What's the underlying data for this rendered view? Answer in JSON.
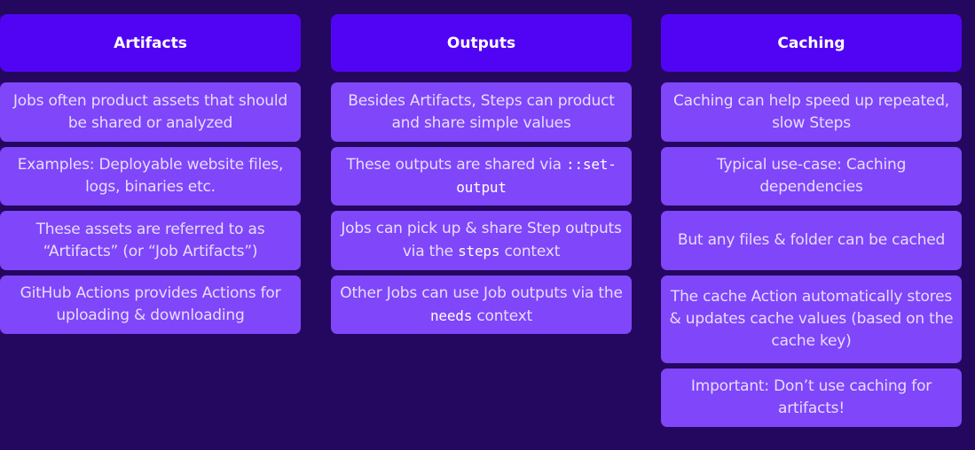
{
  "columns": [
    {
      "title": "Artifacts",
      "cards": [
        [
          {
            "t": "Jobs often product assets that should be shared or analyzed"
          }
        ],
        [
          {
            "t": "Examples: Deployable website files, logs, binaries etc."
          }
        ],
        [
          {
            "t": "These assets are referred to as “Artifacts” (or “Job Artifacts”)"
          }
        ],
        [
          {
            "t": "GitHub Actions provides Actions for uploading & downloading"
          }
        ]
      ]
    },
    {
      "title": "Outputs",
      "cards": [
        [
          {
            "t": "Besides Artifacts, Steps can product and share simple values"
          }
        ],
        [
          {
            "t": "These outputs are shared via "
          },
          {
            "t": "::set-output",
            "code": true
          }
        ],
        [
          {
            "t": "Jobs can pick up & share Step outputs via the "
          },
          {
            "t": "steps",
            "code": true
          },
          {
            "t": " context"
          }
        ],
        [
          {
            "t": "Other Jobs can use Job outputs via the "
          },
          {
            "t": "needs",
            "code": true
          },
          {
            "t": " context"
          }
        ]
      ]
    },
    {
      "title": "Caching",
      "cards": [
        [
          {
            "t": "Caching can help speed up repeated, slow Steps"
          }
        ],
        [
          {
            "t": "Typical use-case: Caching dependencies"
          }
        ],
        [
          {
            "t": "But any files & folder can be cached"
          }
        ],
        [
          {
            "t": "The cache Action automatically stores & updates cache values (based on the cache key)"
          }
        ],
        [
          {
            "t": "Important: Don’t use caching for artifacts!"
          }
        ]
      ]
    }
  ]
}
